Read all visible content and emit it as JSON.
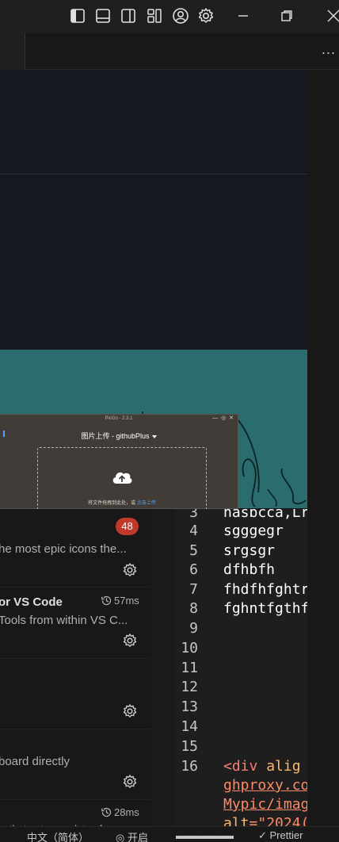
{
  "titlebar": {
    "icons": [
      "toggle-primary-sidebar-icon",
      "toggle-panel-icon",
      "toggle-secondary-sidebar-icon",
      "customize-layout-icon",
      "accounts-icon",
      "manage-gear-icon"
    ],
    "window_controls": [
      "minimize-icon",
      "restore-icon",
      "close-icon"
    ]
  },
  "tabbar": {
    "more_label": "..."
  },
  "picgo": {
    "title": "PicGo - 2.3.1",
    "controls": "— ◎ ✕",
    "heading": "图片上传 - githubPlus",
    "drop_text": "将文件拖拽到此处，或",
    "drop_link": "点击上传"
  },
  "extensions": {
    "badge": "48",
    "items": [
      {
        "desc": "he most epic icons the..."
      },
      {
        "title": "or VS Code",
        "time": "57ms",
        "desc": "Tools from within VS C..."
      },
      {
        "desc": ""
      },
      {
        "desc": "board directly"
      },
      {
        "time": "28ms",
        "desc": "in that autocompletes f..."
      }
    ]
  },
  "editor": {
    "lines": [
      {
        "n": "3",
        "text": "nasbcca,Lr"
      },
      {
        "n": "4",
        "text": "sgggegr"
      },
      {
        "n": "5",
        "text": "srgsgr"
      },
      {
        "n": "6",
        "text": "dfhbfh"
      },
      {
        "n": "7",
        "text": "fhdfhfghtr"
      },
      {
        "n": "8",
        "text": "fghntfgthf"
      },
      {
        "n": "9",
        "text": ""
      },
      {
        "n": "10",
        "text": ""
      },
      {
        "n": "11",
        "text": ""
      },
      {
        "n": "12",
        "text": ""
      },
      {
        "n": "13",
        "text": ""
      },
      {
        "n": "14",
        "text": ""
      },
      {
        "n": "15",
        "text": ""
      },
      {
        "n": "16",
        "tag": "<div",
        "attr": " alig"
      }
    ],
    "wrap": [
      "ghproxy.co",
      "Mypic/imag"
    ],
    "wrap_attr": "alt",
    "wrap_value": "=\"2024("
  },
  "statusbar": {
    "items": [
      "中文（简体）",
      "开启",
      "Prettier"
    ]
  }
}
